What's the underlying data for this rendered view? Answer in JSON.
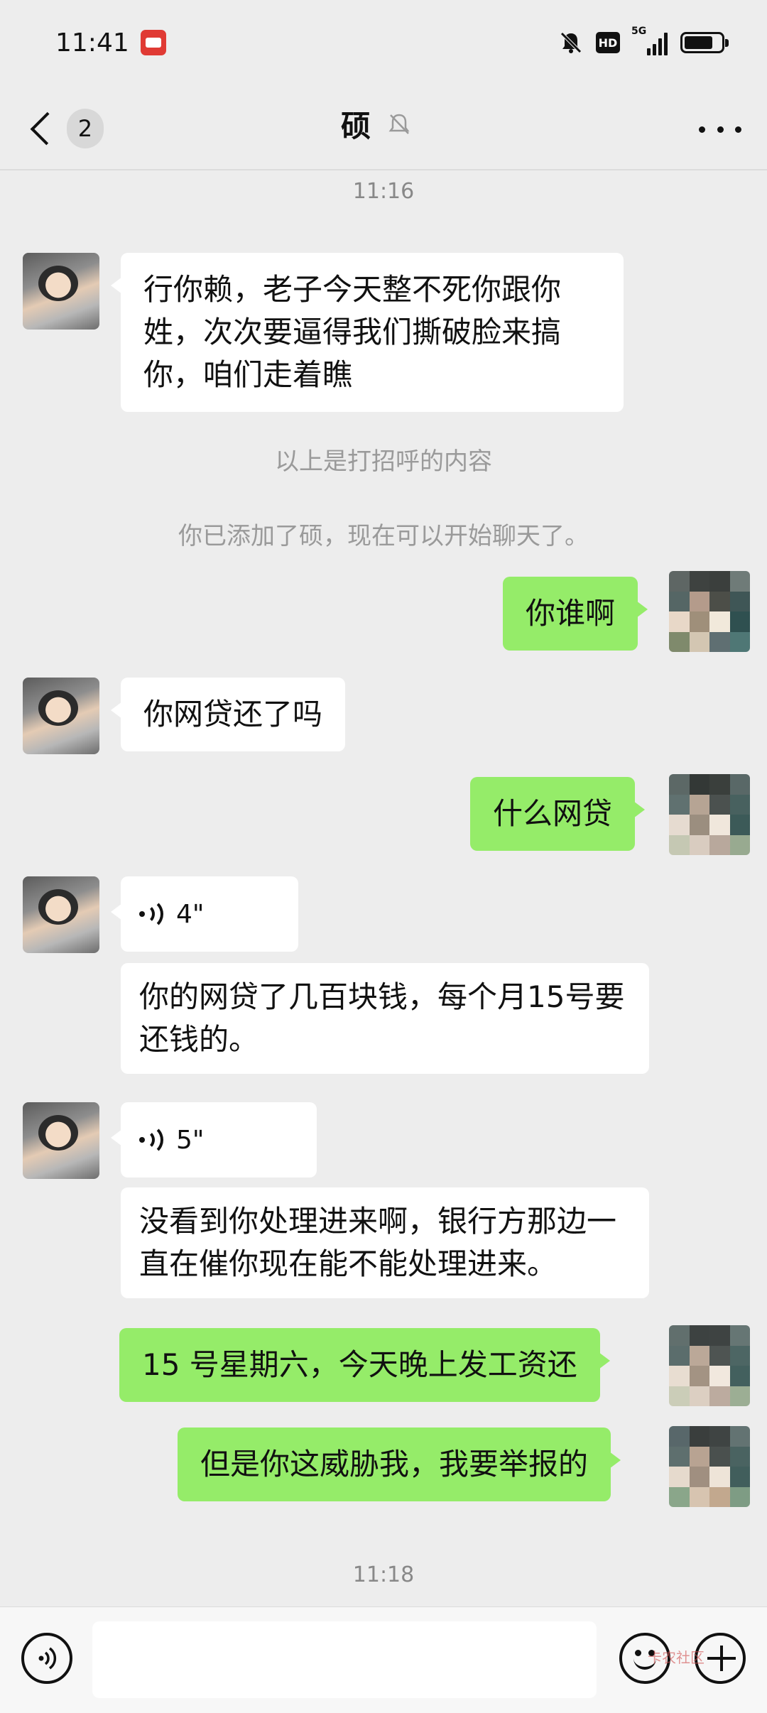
{
  "status_bar": {
    "time": "11:41",
    "network_label": "5G",
    "hd_label": "HD",
    "icons": [
      "app-notification-icon",
      "mute-icon",
      "hd-icon",
      "signal-icon",
      "battery-icon"
    ]
  },
  "header": {
    "unread_count": "2",
    "title": "硕",
    "icons": [
      "back-chevron-icon",
      "mute-bell-icon",
      "more-dots-icon"
    ]
  },
  "chat": {
    "time_1": "11:16",
    "msg_greeting": "行你赖，老子今天整不死你跟你姓，次次要逼得我们撕破脸来搞你，咱们走着瞧",
    "sys_greeting_note": "以上是打招呼的内容",
    "sys_added_note": "你已添加了硕，现在可以开始聊天了。",
    "msg_who": "你谁啊",
    "msg_loan_paid": "你网贷还了吗",
    "msg_what_loan": "什么网贷",
    "voice_1_duration": "4\"",
    "msg_loan_detail": "你的网贷了几百块钱，每个月15号要还钱的。",
    "voice_2_duration": "5\"",
    "msg_bank_urging": "没看到你处理进来啊，银行方那边一直在催你现在能不能处理进来。",
    "msg_saturday": "15 号星期六，今天晚上发工资还",
    "msg_report": "但是你这威胁我，我要举报的",
    "time_2": "11:18"
  },
  "input_bar": {
    "text_value": "",
    "icons": [
      "voice-input-icon",
      "emoji-icon",
      "plus-icon"
    ],
    "watermark": "卡农社区"
  },
  "colors": {
    "background": "#ededed",
    "bubble_self": "#95ec69",
    "bubble_other": "#ffffff",
    "system_text": "#9a9a9a"
  }
}
